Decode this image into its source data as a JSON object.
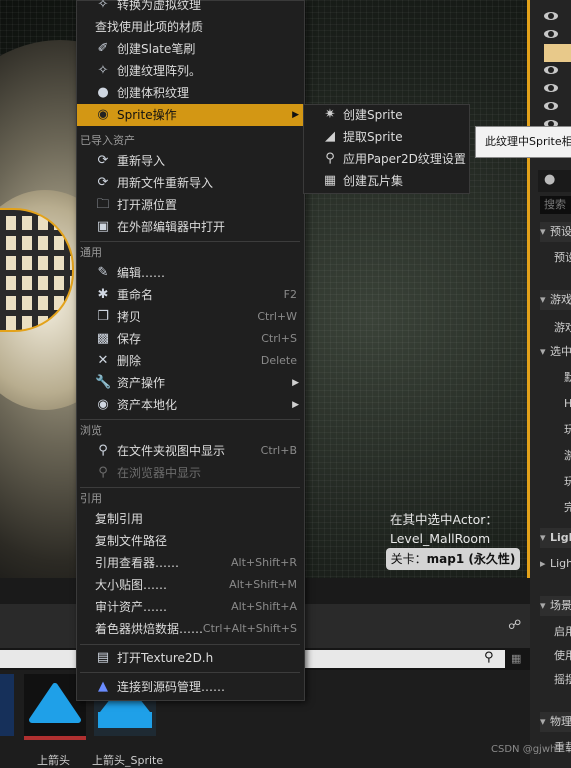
{
  "viewport": {
    "actor_label_line1": "在其中选中Actor：",
    "actor_label_line2": "Level_MallRoom",
    "map_badge_prefix": "关卡：",
    "map_badge_name": "map1 (永久性)"
  },
  "menu": {
    "top_items": [
      {
        "label": "转换为虚拟纹理",
        "icon": "convert-icon"
      },
      {
        "label": "查找使用此项的材质",
        "icon": ""
      },
      {
        "label": "创建Slate笔刷",
        "icon": "brush-icon"
      },
      {
        "label": "创建纹理阵列。",
        "icon": "texture-array-icon"
      },
      {
        "label": "创建体积纹理",
        "icon": "sphere-icon"
      },
      {
        "label": "Sprite操作",
        "icon": "sprite-icon"
      }
    ],
    "imported_header": "已导入资产",
    "imported_items": [
      {
        "label": "重新导入"
      },
      {
        "label": "用新文件重新导入"
      },
      {
        "label": "打开源位置"
      },
      {
        "label": "在外部编辑器中打开"
      }
    ],
    "common_header": "通用",
    "common_items": [
      {
        "label": "编辑……",
        "shortcut": ""
      },
      {
        "label": "重命名",
        "shortcut": "F2"
      },
      {
        "label": "拷贝",
        "shortcut": "Ctrl+W"
      },
      {
        "label": "保存",
        "shortcut": "Ctrl+S"
      },
      {
        "label": "删除",
        "shortcut": "Delete"
      },
      {
        "label": "资产操作",
        "shortcut": ""
      },
      {
        "label": "资产本地化",
        "shortcut": ""
      }
    ],
    "browse_header": "浏览",
    "browse_items": [
      {
        "label": "在文件夹视图中显示",
        "shortcut": "Ctrl+B"
      },
      {
        "label": "在浏览器中显示",
        "shortcut": ""
      }
    ],
    "ref_header": "引用",
    "ref_items": [
      {
        "label": "复制引用",
        "shortcut": ""
      },
      {
        "label": "复制文件路径",
        "shortcut": ""
      },
      {
        "label": "引用查看器……",
        "shortcut": "Alt+Shift+R"
      },
      {
        "label": "大小贴图……",
        "shortcut": "Alt+Shift+M"
      },
      {
        "label": "审计资产……",
        "shortcut": "Alt+Shift+A"
      },
      {
        "label": "着色器烘焙数据……",
        "shortcut": "Ctrl+Alt+Shift+S"
      }
    ],
    "open_header_item": "打开Texture2D.h",
    "source_control": "连接到源码管理……"
  },
  "submenu": {
    "items": [
      {
        "label": "创建Sprite"
      },
      {
        "label": "提取Sprite"
      },
      {
        "label": "应用Paper2D纹理设置"
      },
      {
        "label": "创建瓦片集"
      }
    ]
  },
  "tooltip": "此纹理中Sprite相",
  "right_panel": {
    "search_placeholder": "搜索",
    "rows": [
      "预设",
      "预设",
      "游戏",
      "游戏",
      "选中",
      "默",
      "H",
      "玩",
      "游",
      "玩",
      "完",
      "Ligh",
      "Ligh",
      "场景",
      "启用",
      "使用",
      "摇摆",
      "物理",
      "重载"
    ]
  },
  "content_browser": {
    "assets": [
      {
        "name": "上箭头"
      },
      {
        "name": "上箭头_Sprite"
      }
    ]
  },
  "watermark": "CSDN @gjwh"
}
